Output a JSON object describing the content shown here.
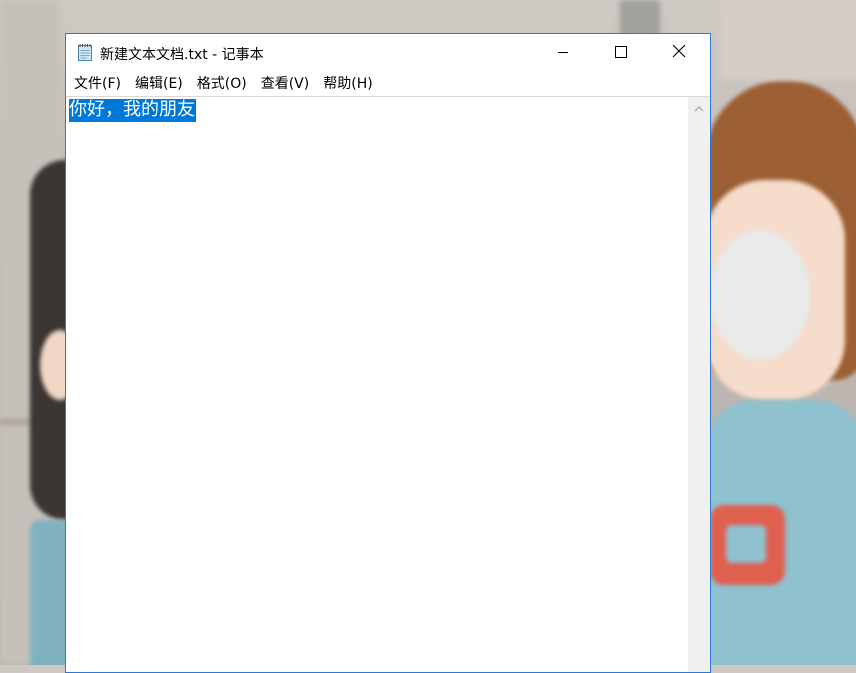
{
  "window": {
    "title": "新建文本文档.txt - 记事本",
    "accent_color": "#2b79d1"
  },
  "menu": {
    "items": [
      {
        "label": "文件(F)"
      },
      {
        "label": "编辑(E)"
      },
      {
        "label": "格式(O)"
      },
      {
        "label": "查看(V)"
      },
      {
        "label": "帮助(H)"
      }
    ]
  },
  "editor": {
    "selected_text": "你好，我的朋友",
    "selection_color": "#0078d7"
  },
  "icons": {
    "app": "notepad-icon",
    "minimize": "minimize-icon",
    "maximize": "maximize-icon",
    "close": "close-icon",
    "scroll_up": "chevron-up-icon"
  }
}
